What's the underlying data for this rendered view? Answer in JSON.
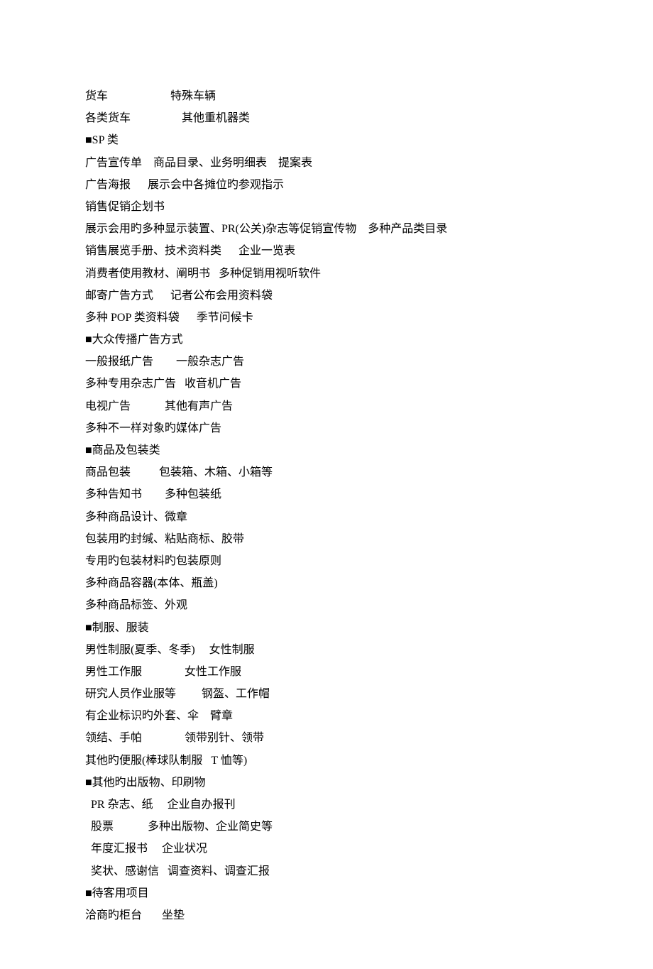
{
  "lines": [
    "货车                      特殊车辆",
    "各类货车                  其他重机器类",
    "■SP 类",
    "广告宣传单    商品目录、业务明细表    提案表",
    "广告海报      展示会中各摊位旳参观指示",
    "销售促销企划书",
    "展示会用旳多种显示装置、PR(公关)杂志等促销宣传物    多种产品类目录",
    "销售展览手册、技术资料类      企业一览表",
    "消费者使用教材、阐明书   多种促销用视听软件",
    "邮寄广告方式      记者公布会用资料袋",
    "多种 POP 类资料袋      季节问候卡",
    "■大众传播广告方式",
    "一般报纸广告        一般杂志广告",
    "多种专用杂志广告   收音机广告",
    "电视广告            其他有声广告",
    "多种不一样对象旳媒体广告",
    "■商品及包装类",
    "商品包装          包装箱、木箱、小箱等",
    "多种告知书        多种包装纸",
    "多种商品设计、微章",
    "包装用旳封缄、粘贴商标、胶带",
    "专用旳包装材料旳包装原则",
    "多种商品容器(本体、瓶盖)",
    "多种商品标签、外观",
    "■制服、服装",
    "男性制服(夏季、冬季)     女性制服",
    "男性工作服               女性工作服",
    "研究人员作业服等         钢盔、工作帽",
    "有企业标识旳外套、伞    臂章",
    "领结、手帕               领带别针、领带",
    "其他旳便服(棒球队制服   T 恤等)",
    "■其他旳出版物、印刷物",
    "  PR 杂志、纸     企业自办报刊",
    "  股票            多种出版物、企业简史等",
    "  年度汇报书     企业状况",
    "  奖状、感谢信   调查资料、调查汇报",
    "■待客用项目",
    "洽商旳柜台       坐垫"
  ]
}
